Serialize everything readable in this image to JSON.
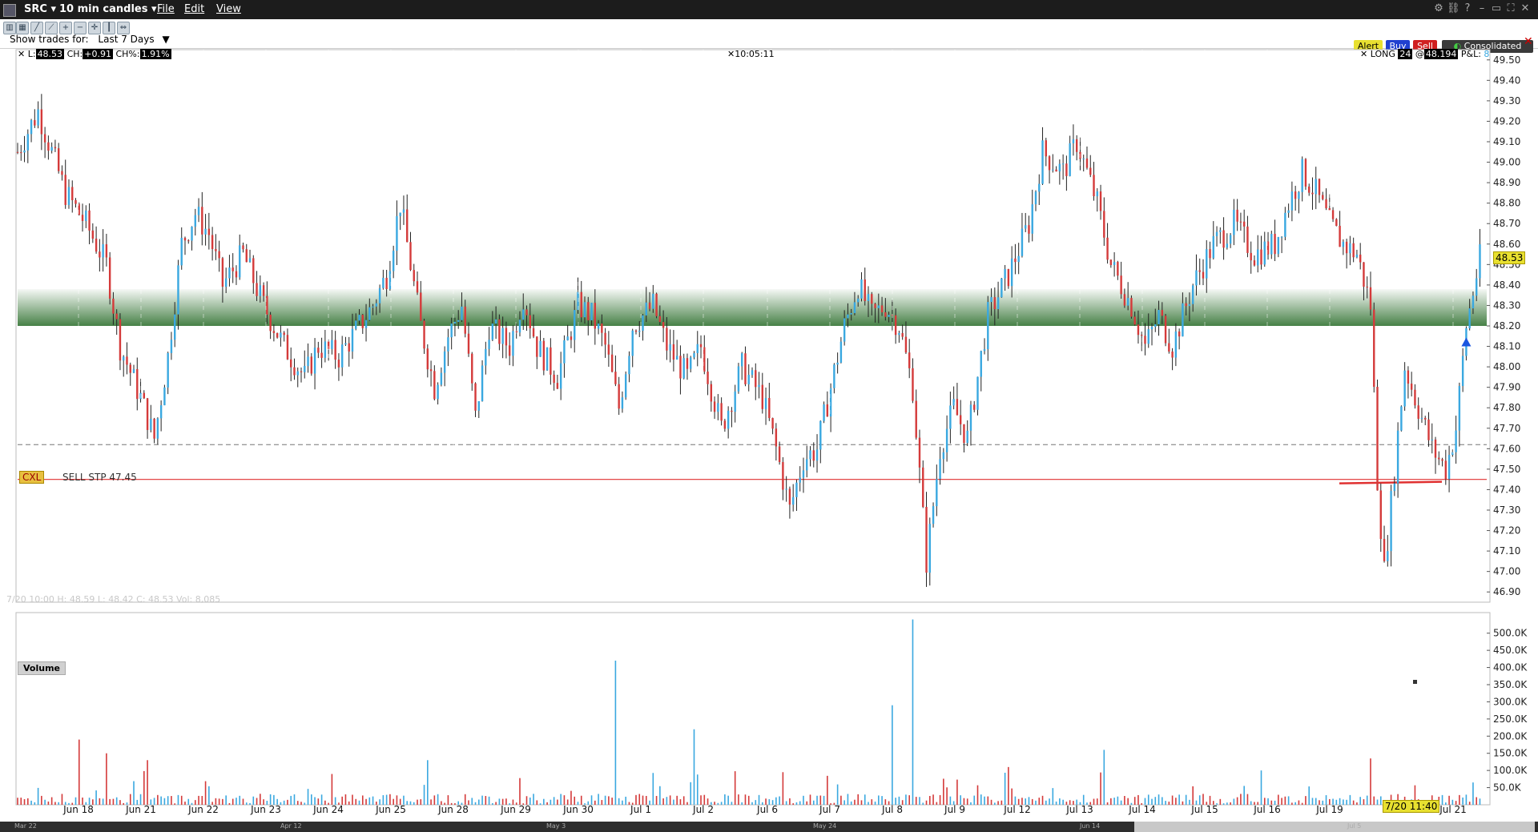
{
  "window": {
    "symbol": "SRC",
    "timeframe": "10 min candles",
    "menu": [
      "File",
      "Edit",
      "View"
    ]
  },
  "toolbar": {
    "show_trades_label": "Show trades for:",
    "show_trades_value": "Last 7 Days",
    "alert": "Alert",
    "buy": "Buy",
    "sell": "Sell",
    "consolidated": "Consolidated"
  },
  "header": {
    "last_label": "L:",
    "last_value": "48.53",
    "change_label": "CH:",
    "change_value": "+0.91",
    "change_pct_label": "CH%:",
    "change_pct_value": "1.91%",
    "time": "10:05:11",
    "position_label": "LONG",
    "position_qty": "24",
    "at": "@",
    "avg_price": "48.194",
    "pnl_label": "P&L:",
    "pnl_value": "8"
  },
  "order": {
    "cxl": "CXL",
    "text": "SELL STP 47.45"
  },
  "bar_info": "7/20 10:00   H: 48.59   L: 48.42   C: 48.53   Vol: 8,085",
  "volume_label": "Volume",
  "current_price_tag": "48.53",
  "cursor_time_tag": "7/20 11:40",
  "scrollbar_labels": [
    "Mar 22",
    "Apr 12",
    "May 3",
    "May 24",
    "Jun 14",
    "Jul 5"
  ],
  "colors": {
    "up": "#3aa8e0",
    "down": "#d43a3a",
    "zone": "#3d7a3d",
    "order_line": "#e03030",
    "tag": "#e8e060"
  },
  "chart_data": {
    "type": "candlestick",
    "ylim": [
      46.85,
      49.55
    ],
    "y_ticks": [
      "49.50",
      "49.40",
      "49.30",
      "49.20",
      "49.10",
      "49.00",
      "48.90",
      "48.80",
      "48.70",
      "48.60",
      "48.50",
      "48.40",
      "48.30",
      "48.20",
      "48.10",
      "48.00",
      "47.90",
      "47.80",
      "47.70",
      "47.60",
      "47.50",
      "47.40",
      "47.30",
      "47.20",
      "47.10",
      "47.00",
      "46.90"
    ],
    "x_ticks": [
      "Jun 18",
      "Jun 21",
      "Jun 22",
      "Jun 23",
      "Jun 24",
      "Jun 25",
      "Jun 28",
      "Jun 29",
      "Jun 30",
      "Jul 1",
      "Jul 2",
      "Jul 6",
      "Jul 7",
      "Jul 8",
      "Jul 9",
      "Jul 12",
      "Jul 13",
      "Jul 14",
      "Jul 15",
      "Jul 16",
      "Jul 19",
      "Jul 21"
    ],
    "price_path": [
      [
        0,
        49.05
      ],
      [
        6,
        49.25
      ],
      [
        14,
        48.85
      ],
      [
        20,
        48.7
      ],
      [
        26,
        48.5
      ],
      [
        30,
        48.1
      ],
      [
        36,
        47.85
      ],
      [
        40,
        47.65
      ],
      [
        44,
        48.05
      ],
      [
        48,
        48.6
      ],
      [
        52,
        48.75
      ],
      [
        56,
        48.65
      ],
      [
        60,
        48.4
      ],
      [
        66,
        48.55
      ],
      [
        72,
        48.3
      ],
      [
        78,
        48.1
      ],
      [
        84,
        47.95
      ],
      [
        88,
        48.1
      ],
      [
        94,
        48.05
      ],
      [
        100,
        48.2
      ],
      [
        104,
        48.3
      ],
      [
        108,
        48.45
      ],
      [
        112,
        48.8
      ],
      [
        118,
        48.2
      ],
      [
        122,
        47.9
      ],
      [
        126,
        48.15
      ],
      [
        130,
        48.3
      ],
      [
        134,
        47.75
      ],
      [
        138,
        48.2
      ],
      [
        144,
        48.1
      ],
      [
        148,
        48.35
      ],
      [
        152,
        48.1
      ],
      [
        158,
        47.95
      ],
      [
        164,
        48.3
      ],
      [
        168,
        48.25
      ],
      [
        172,
        48.1
      ],
      [
        176,
        47.8
      ],
      [
        180,
        48.2
      ],
      [
        186,
        48.3
      ],
      [
        190,
        48.1
      ],
      [
        196,
        47.95
      ],
      [
        200,
        48.1
      ],
      [
        206,
        47.7
      ],
      [
        212,
        48.0
      ],
      [
        218,
        47.85
      ],
      [
        222,
        47.6
      ],
      [
        226,
        47.3
      ],
      [
        230,
        47.55
      ],
      [
        234,
        47.6
      ],
      [
        238,
        47.9
      ],
      [
        242,
        48.2
      ],
      [
        246,
        48.4
      ],
      [
        250,
        48.25
      ],
      [
        254,
        48.3
      ],
      [
        258,
        48.2
      ],
      [
        262,
        47.9
      ],
      [
        266,
        47.05
      ],
      [
        270,
        47.6
      ],
      [
        274,
        47.8
      ],
      [
        278,
        47.65
      ],
      [
        284,
        48.25
      ],
      [
        290,
        48.45
      ],
      [
        296,
        48.7
      ],
      [
        300,
        49.05
      ],
      [
        306,
        48.95
      ],
      [
        310,
        49.1
      ],
      [
        316,
        48.8
      ],
      [
        320,
        48.5
      ],
      [
        326,
        48.3
      ],
      [
        330,
        48.1
      ],
      [
        334,
        48.25
      ],
      [
        338,
        48.1
      ],
      [
        344,
        48.4
      ],
      [
        350,
        48.6
      ],
      [
        356,
        48.7
      ],
      [
        362,
        48.55
      ],
      [
        368,
        48.6
      ],
      [
        372,
        48.8
      ],
      [
        376,
        48.95
      ],
      [
        380,
        48.85
      ],
      [
        384,
        48.7
      ],
      [
        388,
        48.6
      ],
      [
        392,
        48.55
      ],
      [
        396,
        48.3
      ],
      [
        398,
        47.45
      ],
      [
        400,
        47.0
      ],
      [
        403,
        47.5
      ],
      [
        406,
        48.0
      ],
      [
        410,
        47.8
      ],
      [
        414,
        47.6
      ],
      [
        418,
        47.5
      ],
      [
        421,
        47.7
      ],
      [
        424,
        48.2
      ],
      [
        428,
        48.53
      ]
    ],
    "volume_ticks": [
      "500.0K",
      "450.0K",
      "400.0K",
      "350.0K",
      "300.0K",
      "250.0K",
      "200.0K",
      "150.0K",
      "100.0K",
      "50.0K"
    ],
    "volume_max": 560000,
    "volume_spikes": [
      [
        18,
        190000
      ],
      [
        26,
        150000
      ],
      [
        38,
        130000
      ],
      [
        120,
        130000
      ],
      [
        175,
        420000
      ],
      [
        198,
        220000
      ],
      [
        224,
        95000
      ],
      [
        256,
        290000
      ],
      [
        262,
        540000
      ],
      [
        290,
        110000
      ],
      [
        318,
        160000
      ],
      [
        364,
        100000
      ],
      [
        396,
        135000
      ],
      [
        426,
        65000
      ]
    ],
    "resistance_zone": [
      48.2,
      48.38
    ],
    "dashed_level": 47.62,
    "sell_stop": 47.45
  }
}
